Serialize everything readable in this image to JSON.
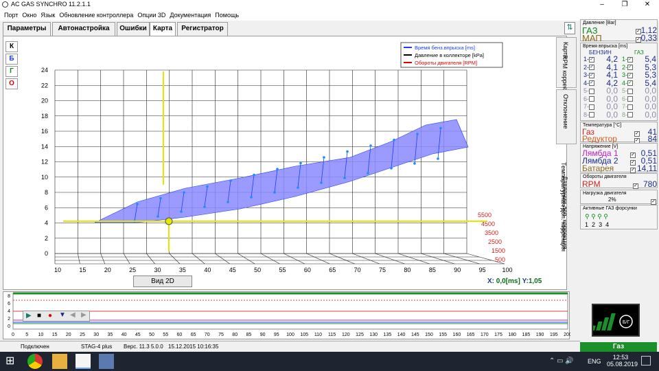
{
  "window": {
    "title": "AC GAS SYNCHRO  11.2.1.1",
    "min": "–",
    "max": "❐",
    "close": "✕"
  },
  "menu": [
    "Порт",
    "Окно",
    "Язык",
    "Обновление контроллера",
    "Опции 3D",
    "Документация",
    "Помощь"
  ],
  "tabs": [
    "Параметры",
    "Автонастройка",
    "Ошибки",
    "Карта",
    "Регистратор"
  ],
  "side_buttons": [
    "К",
    "Б",
    "Г",
    "О"
  ],
  "legend": [
    "Время бенз.впрыска [ms]",
    "Давление в коллекторе [kPa]",
    "Обороты двигателя [RPM]"
  ],
  "colors": {
    "series_petrol": "#1a3cff",
    "series_pressure": "#000000",
    "series_rpm": "#e00000",
    "surface": "#8a8aff",
    "axis_cursor": "#e6e600",
    "gas_green": "#1a8f2a"
  },
  "axes": {
    "x_ticks": [
      "10",
      "15",
      "20",
      "25",
      "30",
      "35",
      "40",
      "45",
      "50",
      "55",
      "60",
      "65",
      "70",
      "75",
      "80",
      "85",
      "90",
      "95",
      "100"
    ],
    "y_ticks": [
      "0",
      "2",
      "4",
      "6",
      "8",
      "10",
      "12",
      "14",
      "16",
      "18",
      "20",
      "22",
      "24"
    ],
    "rpm_ticks": [
      "5500",
      "4500",
      "3500",
      "2500",
      "1500",
      "500"
    ]
  },
  "view2d": "Вид 2D",
  "readout": {
    "x_label": "X:",
    "x_value": "0,0[ms]",
    "y_label": "Y:",
    "y_value": "1,05"
  },
  "vertical_tabs": [
    "Карта",
    "RPM коррекция",
    "Отклонение",
    "Давлении доп. коррекция",
    "Температурная доп. коррекция"
  ],
  "pressure": {
    "title": "Давление [Bar]",
    "rows": [
      {
        "name": "ГАЗ",
        "value": "1,12"
      },
      {
        "name": "МАП",
        "value": "0,33"
      }
    ]
  },
  "injection": {
    "title": "Время впрыска [ms]",
    "petrol_label": "БЕНЗИН",
    "gas_label": "ГАЗ",
    "rows": [
      {
        "n": "1",
        "on": true,
        "petrol": "4,2",
        "gas": "5,4"
      },
      {
        "n": "2",
        "on": true,
        "petrol": "4,1",
        "gas": "5,3"
      },
      {
        "n": "3",
        "on": true,
        "petrol": "4,1",
        "gas": "5,3"
      },
      {
        "n": "4",
        "on": true,
        "petrol": "4,2",
        "gas": "5,4"
      },
      {
        "n": "5",
        "on": false,
        "petrol": "0,0",
        "gas": "0,0"
      },
      {
        "n": "6",
        "on": false,
        "petrol": "0,0",
        "gas": "0,0"
      },
      {
        "n": "7",
        "on": false,
        "petrol": "0,0",
        "gas": "0,0"
      },
      {
        "n": "8",
        "on": false,
        "petrol": "0,0",
        "gas": "0,0"
      }
    ]
  },
  "temperature": {
    "title": "Температура [°C]",
    "rows": [
      {
        "name": "Газ",
        "value": "41"
      },
      {
        "name": "Редуктор",
        "value": "84"
      }
    ]
  },
  "voltage": {
    "title": "Напряжение [V]",
    "rows": [
      {
        "name": "Лямбда 1",
        "value": "0,51"
      },
      {
        "name": "Лямбда 2",
        "value": "0,51"
      },
      {
        "name": "Батарея",
        "value": "14,11"
      }
    ]
  },
  "rpm": {
    "title": "Обороты двигателя",
    "name": "RPM",
    "value": "780"
  },
  "load": {
    "title": "Нагрузка двигателя",
    "value": "2%"
  },
  "injectors": {
    "title": "Активные ГАЗ форсунки",
    "labels": [
      "1",
      "2",
      "3",
      "4"
    ]
  },
  "strip": {
    "y_ticks": [
      "8",
      "6",
      "4",
      "2",
      "0"
    ],
    "x_ticks": [
      "0",
      "5",
      "10",
      "15",
      "20",
      "25",
      "30",
      "35",
      "40",
      "45",
      "50",
      "55",
      "60",
      "65",
      "70",
      "75",
      "80",
      "85",
      "90",
      "95",
      "100",
      "105",
      "110",
      "115",
      "120",
      "125",
      "130",
      "135",
      "140",
      "145",
      "150",
      "155",
      "160",
      "165",
      "170",
      "175",
      "180",
      "185",
      "190",
      "195",
      "200"
    ]
  },
  "status": {
    "connection": "Подключен",
    "controller": "STAG-4 plus",
    "version": "Верс. 11.3  5.0.0",
    "date": "15.12.2015 10:16:35"
  },
  "gauge_label": "Газ",
  "taskbar": {
    "lang": "ENG",
    "time": "12:53",
    "date": "05.08.2019"
  }
}
